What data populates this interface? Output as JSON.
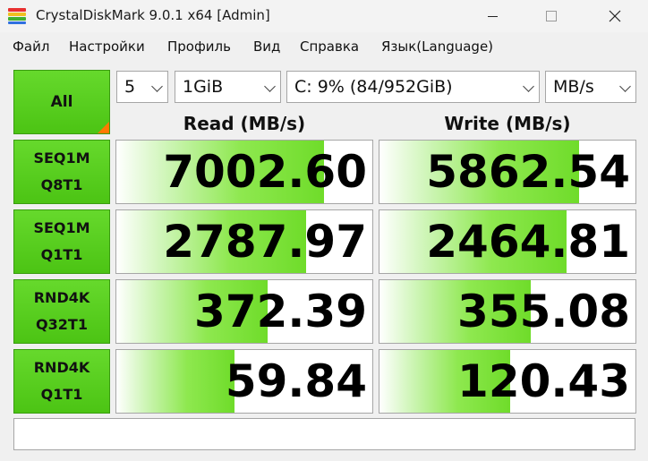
{
  "window": {
    "title": "CrystalDiskMark 9.0.1 x64 [Admin]",
    "icon_colors": [
      "#e83030",
      "#f0c020",
      "#40b030",
      "#3070e0"
    ]
  },
  "menu": {
    "items": [
      "Файл",
      "Настройки",
      "Профиль",
      "Вид",
      "Справка",
      "Язык(Language)"
    ]
  },
  "controls": {
    "all_label": "All",
    "count": "5",
    "size": "1GiB",
    "drive": "C: 9% (84/952GiB)",
    "unit": "MB/s"
  },
  "headers": {
    "read": "Read (MB/s)",
    "write": "Write (MB/s)"
  },
  "tests": [
    {
      "line1": "SEQ1M",
      "line2": "Q8T1",
      "read": "7002.60",
      "write": "5862.54",
      "read_fill": 0.81,
      "write_fill": 0.78
    },
    {
      "line1": "SEQ1M",
      "line2": "Q1T1",
      "read": "2787.97",
      "write": "2464.81",
      "read_fill": 0.74,
      "write_fill": 0.73
    },
    {
      "line1": "RND4K",
      "line2": "Q32T1",
      "read": "372.39",
      "write": "355.08",
      "read_fill": 0.59,
      "write_fill": 0.59
    },
    {
      "line1": "RND4K",
      "line2": "Q1T1",
      "read": "59.84",
      "write": "120.43",
      "read_fill": 0.46,
      "write_fill": 0.51
    }
  ],
  "comment": "",
  "colors": {
    "accent_green": "#4cc414",
    "corner_orange": "#ff7a00"
  }
}
